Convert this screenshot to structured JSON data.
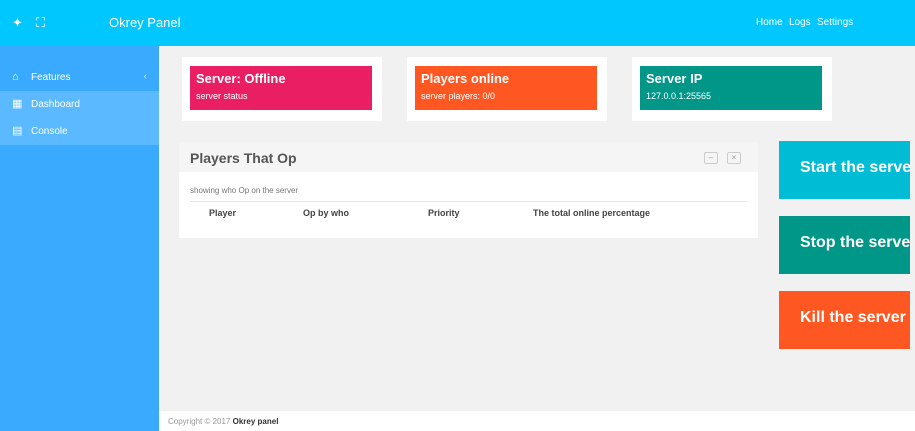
{
  "app": {
    "brand": "Okrey Panel"
  },
  "topbar": {
    "nav": [
      "Home",
      "Logs",
      "Settings"
    ]
  },
  "sidebar": {
    "items": [
      {
        "label": "Features"
      },
      {
        "label": "Dashboard"
      },
      {
        "label": "Console"
      }
    ]
  },
  "cards": [
    {
      "title": "Server: Offline",
      "value": "server status",
      "color": "#e91e63"
    },
    {
      "title": "Players online",
      "value": "server players: 0/0",
      "color": "#ff5722"
    },
    {
      "title": "Server IP",
      "value": "127.0.0.1:25565",
      "color": "#009688"
    }
  ],
  "panel": {
    "title": "Players That Op",
    "subtitle": "showing who Op on the server",
    "columns": [
      "Player",
      "Op by who",
      "Priority",
      "The total online percentage"
    ]
  },
  "actions": [
    {
      "label": "Start the server",
      "color": "#00bcd4"
    },
    {
      "label": "Stop the server",
      "color": "#009688"
    },
    {
      "label": "Kill the server",
      "color": "#ff5722"
    }
  ],
  "footer": {
    "prefix": "Copyright © 2017",
    "brand": "Okrey panel"
  }
}
